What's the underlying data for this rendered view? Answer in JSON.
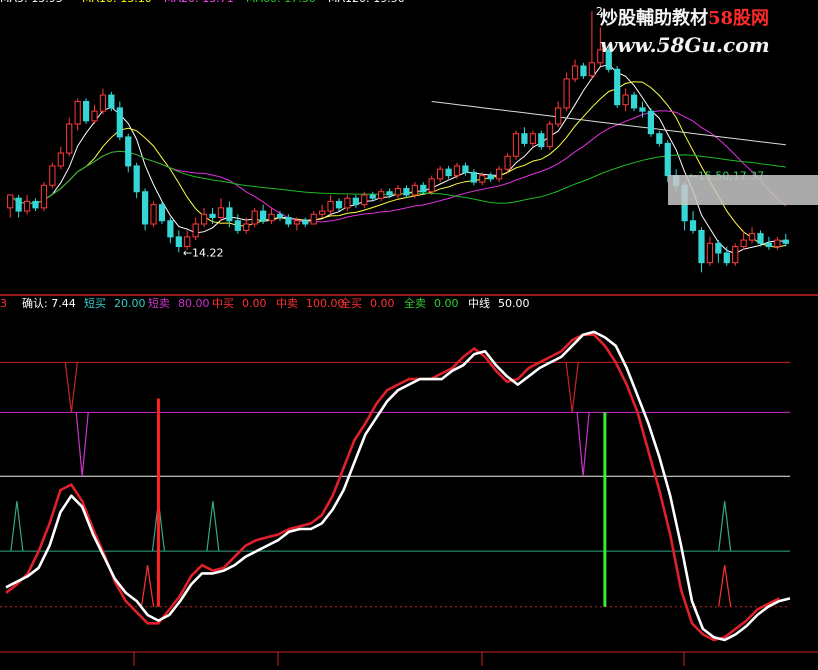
{
  "chart_data": {
    "type": "stock-indicator",
    "watermark": {
      "line1_prefix": "炒股輔助教材",
      "line1_brand": "58股网",
      "line2": "www.58Gu.com"
    },
    "price_panel": {
      "type": "candlestick",
      "top_ma_legend": [
        {
          "label": "MA5: 15.95",
          "color": "#ffffff"
        },
        {
          "label": "MA10: 15.10",
          "color": "#ffff00"
        },
        {
          "label": "MA20: 15.71",
          "color": "#ff44ff"
        },
        {
          "label": "MA60: 17.30",
          "color": "#22cc22"
        },
        {
          "label": "MA120: 19.50",
          "color": "#ffffff"
        }
      ],
      "ylim": [
        13.3,
        21.8
      ],
      "candles": [
        [
          15.6,
          16.0,
          15.8,
          15.3
        ],
        [
          15.9,
          15.5,
          16.0,
          15.3
        ],
        [
          15.5,
          15.8,
          16.0,
          15.4
        ],
        [
          15.8,
          15.6,
          15.9,
          15.5
        ],
        [
          15.6,
          16.3,
          16.4,
          15.5
        ],
        [
          16.3,
          16.9,
          17.0,
          16.2
        ],
        [
          16.9,
          17.3,
          17.5,
          16.8
        ],
        [
          17.3,
          18.2,
          18.4,
          17.2
        ],
        [
          18.2,
          18.9,
          19.0,
          18.0
        ],
        [
          18.9,
          18.3,
          19.0,
          18.2
        ],
        [
          18.3,
          18.6,
          18.8,
          18.2
        ],
        [
          18.6,
          19.1,
          19.3,
          18.5
        ],
        [
          19.1,
          18.7,
          19.2,
          18.6
        ],
        [
          18.7,
          17.8,
          18.9,
          17.7
        ],
        [
          17.8,
          16.9,
          17.9,
          16.7
        ],
        [
          16.9,
          16.1,
          17.0,
          15.9
        ],
        [
          16.1,
          15.1,
          16.2,
          14.9
        ],
        [
          15.1,
          15.7,
          15.8,
          15.0
        ],
        [
          15.7,
          15.2,
          15.8,
          15.1
        ],
        [
          15.2,
          14.7,
          15.3,
          14.5
        ],
        [
          14.7,
          14.4,
          14.9,
          14.22
        ],
        [
          14.4,
          14.7,
          14.9,
          14.3
        ],
        [
          14.7,
          15.1,
          15.3,
          14.6
        ],
        [
          15.1,
          15.4,
          15.6,
          15.0
        ],
        [
          15.4,
          15.3,
          15.6,
          15.1
        ],
        [
          15.3,
          15.6,
          15.9,
          15.2
        ],
        [
          15.6,
          15.2,
          15.8,
          15.0
        ],
        [
          15.2,
          14.9,
          15.4,
          14.8
        ],
        [
          14.9,
          15.1,
          15.3,
          14.8
        ],
        [
          15.1,
          15.5,
          15.6,
          15.0
        ],
        [
          15.5,
          15.2,
          15.7,
          15.1
        ],
        [
          15.2,
          15.4,
          15.6,
          15.1
        ],
        [
          15.4,
          15.3,
          15.5,
          15.2
        ],
        [
          15.3,
          15.1,
          15.4,
          15.0
        ],
        [
          15.1,
          15.2,
          15.3,
          14.9
        ],
        [
          15.2,
          15.1,
          15.3,
          15.0
        ],
        [
          15.1,
          15.4,
          15.5,
          15.1
        ],
        [
          15.4,
          15.5,
          15.7,
          15.3
        ],
        [
          15.5,
          15.8,
          16.0,
          15.4
        ],
        [
          15.8,
          15.6,
          15.9,
          15.5
        ],
        [
          15.6,
          15.9,
          16.0,
          15.5
        ],
        [
          15.9,
          15.7,
          16.0,
          15.6
        ],
        [
          15.7,
          16.0,
          16.1,
          15.6
        ],
        [
          16.0,
          15.9,
          16.1,
          15.8
        ],
        [
          15.9,
          16.1,
          16.2,
          15.8
        ],
        [
          16.1,
          16.0,
          16.2,
          15.9
        ],
        [
          16.0,
          16.2,
          16.3,
          15.9
        ],
        [
          16.2,
          16.0,
          16.3,
          15.9
        ],
        [
          16.0,
          16.3,
          16.4,
          15.9
        ],
        [
          16.3,
          16.1,
          16.4,
          16.0
        ],
        [
          16.1,
          16.5,
          16.6,
          16.0
        ],
        [
          16.5,
          16.8,
          16.9,
          16.4
        ],
        [
          16.8,
          16.6,
          16.9,
          16.5
        ],
        [
          16.6,
          16.9,
          17.0,
          16.5
        ],
        [
          16.9,
          16.7,
          17.0,
          16.6
        ],
        [
          16.7,
          16.4,
          16.8,
          16.3
        ],
        [
          16.4,
          16.6,
          16.7,
          16.3
        ],
        [
          16.6,
          16.5,
          16.7,
          16.4
        ],
        [
          16.5,
          16.8,
          16.9,
          16.4
        ],
        [
          16.8,
          17.2,
          17.3,
          16.7
        ],
        [
          17.2,
          17.9,
          18.0,
          17.1
        ],
        [
          17.9,
          17.6,
          18.1,
          17.5
        ],
        [
          17.6,
          17.9,
          18.0,
          17.5
        ],
        [
          17.9,
          17.5,
          18.0,
          17.4
        ],
        [
          17.5,
          18.2,
          18.3,
          17.4
        ],
        [
          18.2,
          18.7,
          18.9,
          18.1
        ],
        [
          18.7,
          19.6,
          19.8,
          18.6
        ],
        [
          19.6,
          20.0,
          20.2,
          19.5
        ],
        [
          20.0,
          19.7,
          20.1,
          19.6
        ],
        [
          19.7,
          20.1,
          21.7,
          19.6
        ],
        [
          20.1,
          20.5,
          21.2,
          20.0
        ],
        [
          20.5,
          19.9,
          20.6,
          19.8
        ],
        [
          19.9,
          18.8,
          20.0,
          18.7
        ],
        [
          18.8,
          19.1,
          19.3,
          18.6
        ],
        [
          19.1,
          18.7,
          19.2,
          18.6
        ],
        [
          18.7,
          18.6,
          18.9,
          18.4
        ],
        [
          18.6,
          17.9,
          18.7,
          17.8
        ],
        [
          17.9,
          17.6,
          18.0,
          17.5
        ],
        [
          17.6,
          16.6,
          17.7,
          16.4
        ],
        [
          16.6,
          16.3,
          16.8,
          16.1
        ],
        [
          16.3,
          15.2,
          16.4,
          14.9
        ],
        [
          15.2,
          14.9,
          15.5,
          14.8
        ],
        [
          14.9,
          13.9,
          15.0,
          13.6
        ],
        [
          13.9,
          14.5,
          14.7,
          13.8
        ],
        [
          14.5,
          14.2,
          14.6,
          13.9
        ],
        [
          14.2,
          13.9,
          14.4,
          13.8
        ],
        [
          13.9,
          14.4,
          14.5,
          13.8
        ],
        [
          14.4,
          14.6,
          14.9,
          14.3
        ],
        [
          14.6,
          14.8,
          15.0,
          14.5
        ],
        [
          14.8,
          14.5,
          14.9,
          14.4
        ],
        [
          14.5,
          14.4,
          14.7,
          14.3
        ],
        [
          14.4,
          14.6,
          14.7,
          14.3
        ],
        [
          14.6,
          14.5,
          14.8,
          14.4
        ]
      ],
      "labels": [
        {
          "text": "←14.22",
          "at_index": 20,
          "price": 14.22,
          "color": "#ffffff"
        },
        {
          "text": "←15.50,17.37",
          "at_index": 80,
          "price": 16.6,
          "color": "#33cc66"
        },
        {
          "text": "2",
          "at_index": 69,
          "price": 21.7,
          "color": "#ffffff"
        }
      ]
    },
    "indicator_panel": {
      "legend_left_marker": "3",
      "legend": [
        {
          "label": "确认",
          "value": "7.44",
          "color": "#ffffff"
        },
        {
          "label": "短买",
          "value": "20.00",
          "color": "#33cccc"
        },
        {
          "label": "短卖",
          "value": "80.00",
          "color": "#cc33cc"
        },
        {
          "label": "中买",
          "value": "0.00",
          "color": "#ff3333"
        },
        {
          "label": "中卖",
          "value": "100.00",
          "color": "#ff3333"
        },
        {
          "label": "全买",
          "value": "0.00",
          "color": "#ff3333"
        },
        {
          "label": "全卖",
          "value": "0.00",
          "color": "#33cc33"
        },
        {
          "label": "中线",
          "value": "50.00",
          "color": "#ffffff"
        }
      ],
      "ylim": [
        -12,
        104
      ],
      "reference_lines": [
        {
          "value": 88,
          "color": "#cc2222"
        },
        {
          "value": 70,
          "color": "#cc33cc"
        },
        {
          "value": 47,
          "color": "#eeeeee"
        },
        {
          "value": 20,
          "color": "#33aa88"
        },
        {
          "value": 0,
          "color": "#cc2222",
          "dashed": true
        }
      ],
      "white_line": [
        7,
        9,
        11,
        14,
        22,
        34,
        40,
        36,
        26,
        18,
        10,
        5,
        2,
        -3,
        -5,
        -3,
        2,
        8,
        12,
        12,
        13,
        15,
        18,
        20,
        22,
        24,
        27,
        28,
        28,
        30,
        35,
        42,
        52,
        62,
        68,
        74,
        78,
        80,
        82,
        82,
        82,
        85,
        87,
        91,
        92,
        87,
        83,
        80,
        83,
        86,
        88,
        90,
        94,
        98,
        99,
        97,
        94,
        86,
        76,
        66,
        54,
        40,
        22,
        2,
        -8,
        -11,
        -12,
        -10,
        -7,
        -3,
        0,
        2,
        3
      ],
      "red_line": [
        5,
        8,
        12,
        20,
        30,
        42,
        44,
        38,
        28,
        19,
        9,
        2,
        -2,
        -6,
        -6,
        -1,
        4,
        11,
        15,
        13,
        14,
        18,
        22,
        24,
        25,
        26,
        28,
        29,
        30,
        33,
        40,
        50,
        60,
        66,
        73,
        78,
        80,
        82,
        82,
        82,
        84,
        86,
        90,
        93,
        90,
        85,
        81,
        82,
        86,
        88,
        90,
        92,
        96,
        98,
        98,
        94,
        88,
        80,
        70,
        56,
        42,
        26,
        6,
        -6,
        -10,
        -12,
        -11,
        -8,
        -5,
        -1,
        1,
        3
      ],
      "signal_spikes": [
        {
          "series": "短卖",
          "index": 6,
          "from": 88,
          "to": 70,
          "color": "#cc2222",
          "shape": "v"
        },
        {
          "series": "短卖",
          "index": 7,
          "from": 70,
          "to": 47,
          "color": "#cc33cc",
          "shape": "v"
        },
        {
          "series": "短买",
          "index": 1,
          "from": 20,
          "to": 38,
          "color": "#33aa88",
          "shape": "peak"
        },
        {
          "series": "短买",
          "index": 14,
          "from": 20,
          "to": 38,
          "color": "#33aa88",
          "shape": "peak"
        },
        {
          "series": "短买",
          "index": 19,
          "from": 20,
          "to": 38,
          "color": "#33aa88",
          "shape": "peak"
        },
        {
          "series": "短买",
          "index": 66,
          "from": 20,
          "to": 38,
          "color": "#33aa88",
          "shape": "peak"
        },
        {
          "series": "全买",
          "index": 13,
          "from": 0,
          "to": 15,
          "color": "#ff3333",
          "shape": "peak"
        },
        {
          "series": "全买",
          "index": 66,
          "from": 0,
          "to": 15,
          "color": "#ff3333",
          "shape": "peak"
        },
        {
          "series": "短卖",
          "index": 52,
          "from": 88,
          "to": 70,
          "color": "#cc2222",
          "shape": "v"
        },
        {
          "series": "短卖",
          "index": 53,
          "from": 70,
          "to": 47,
          "color": "#cc33cc",
          "shape": "v"
        }
      ],
      "bars": [
        {
          "series": "中买",
          "index": 14,
          "from": 0,
          "to": 75,
          "color": "#ff2222"
        },
        {
          "series": "全卖",
          "index": 55,
          "from": 0,
          "to": 70,
          "color": "#33ee33"
        }
      ]
    }
  }
}
